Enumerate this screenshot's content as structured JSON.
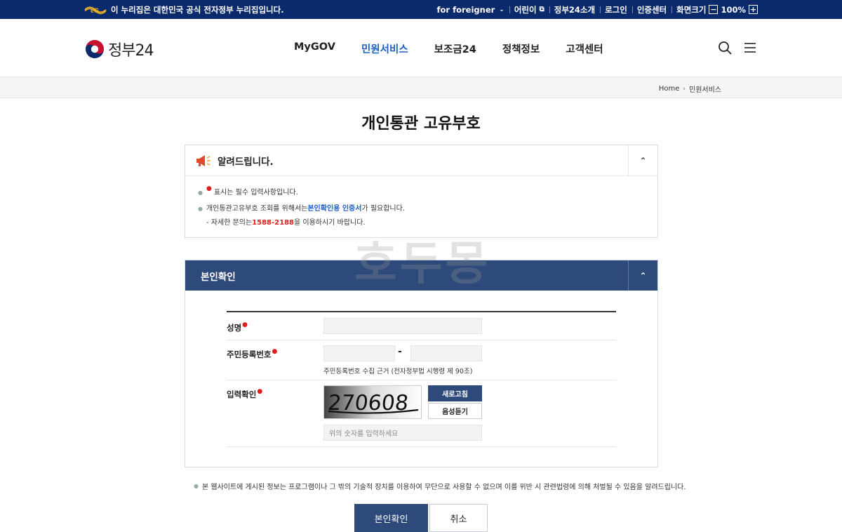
{
  "topbar": {
    "official_text": "이 누리집은 대한민국 공식 전자정부 누리집입니다.",
    "menu": {
      "foreigner": "for foreigner",
      "kids": "어린이",
      "about": "정부24소개",
      "login": "로그인",
      "cert": "인증센터",
      "zoom_label": "화면크기",
      "zoom_value": "100%"
    }
  },
  "header": {
    "logo_text": "정부24",
    "nav": [
      "MyGOV",
      "민원서비스",
      "보조금24",
      "정책정보",
      "고객센터"
    ],
    "active_nav": "민원서비스"
  },
  "breadcrumb": {
    "home": "Home",
    "current": "민원서비스"
  },
  "page_title": "개인통관 고유부호",
  "notice": {
    "title": "알려드립니다.",
    "required_note": "표시는 필수 입력사항입니다.",
    "line2_prefix": "개인통관고유부호 조회를 위해서는 ",
    "line2_link": "본인확인용 인증서",
    "line2_suffix": "가 필요합니다.",
    "line3_prefix": "- 자세한 문의는 ",
    "line3_phone": "1588-2188",
    "line3_suffix": "을 이용하시기 바랍니다."
  },
  "watermark": "호두몽",
  "verify": {
    "title": "본인확인",
    "name_label": "성명",
    "rrn_label": "주민등록번호",
    "rrn_hint": "주민등록번호 수집 근거 (전자정부법 시행령 제 90조)",
    "captcha_label": "입력확인",
    "captcha_text": "270608",
    "refresh_label": "새로고침",
    "voice_label": "음성듣기",
    "captcha_placeholder": "위의 숫자를 입력하세요"
  },
  "disclaimer": "본 웹사이트에 게시된 정보는 프로그램이나 그 밖의 기술적 장치를 이용하여 무단으로 사용할 수 없으며 이를 위반 시 관련법령에 의해 처벌될 수 있음을 알려드립니다.",
  "buttons": {
    "confirm": "본인확인",
    "cancel": "취소"
  },
  "colors": {
    "topbar": "#0b2a6b",
    "accent": "#1c5fc6",
    "panel_header": "#2e4a7a",
    "required": "#e01e1e"
  }
}
